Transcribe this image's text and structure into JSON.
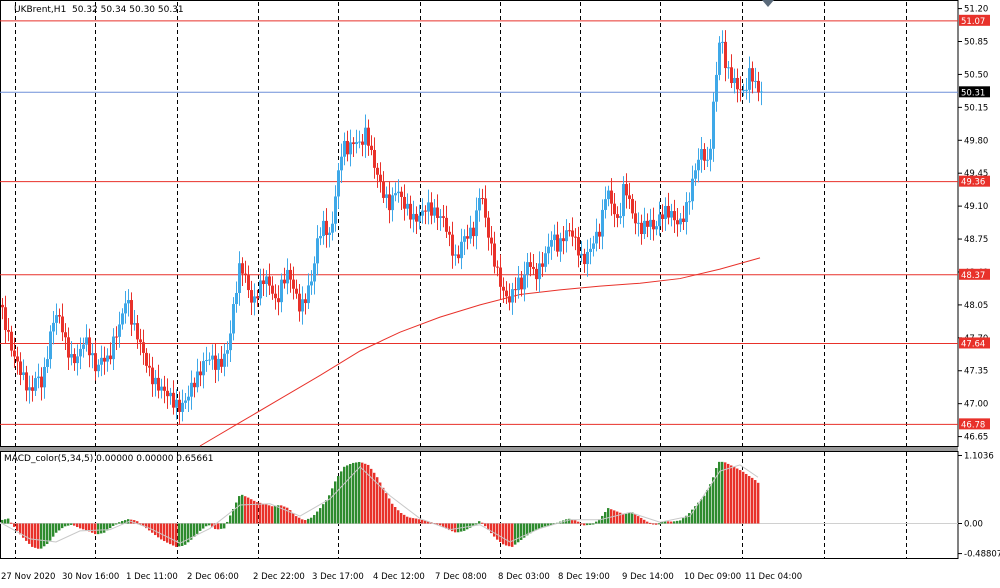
{
  "header": {
    "symbol": "UKBrent,H1",
    "ohlc": "50.32 50.34 50.30 50.31"
  },
  "macd_header": "MACD_color(5,34,5) 0.00000 0.00000 0.65661",
  "colors": {
    "bull": "#3ea8e8",
    "bear": "#e8312a",
    "level_line": "#e8312a",
    "ma": "#e8312a",
    "bid_line": "#6e8fd8",
    "macd_pos": "#2e8b2e",
    "macd_neg": "#e8312a",
    "macd_signal": "#c8c8c8"
  },
  "chart_data": [
    {
      "type": "candlestick",
      "title": "UKBrent,H1",
      "ylim": [
        46.55,
        51.27
      ],
      "y_ticks": [
        "51.20",
        "50.85",
        "50.50",
        "50.15",
        "49.80",
        "49.45",
        "49.10",
        "48.75",
        "48.40",
        "48.05",
        "47.70",
        "47.35",
        "47.00",
        "46.65"
      ],
      "x_ticks": [
        "27 Nov 2020",
        "30 Nov 16:00",
        "1 Dec 11:00",
        "2 Dec 06:00",
        "2 Dec 22:00",
        "3 Dec 17:00",
        "4 Dec 12:00",
        "7 Dec 08:00",
        "8 Dec 03:00",
        "8 Dec 19:00",
        "9 Dec 14:00",
        "10 Dec 09:00",
        "11 Dec 04:00"
      ],
      "levels": [
        51.07,
        49.36,
        48.37,
        47.64,
        46.78
      ],
      "current_price": 50.31,
      "close_path": [
        [
          0,
          48.05
        ],
        [
          6,
          47.8
        ],
        [
          12,
          47.55
        ],
        [
          18,
          47.4
        ],
        [
          24,
          47.25
        ],
        [
          30,
          47.1
        ],
        [
          36,
          47.3
        ],
        [
          42,
          47.2
        ],
        [
          48,
          47.6
        ],
        [
          54,
          47.95
        ],
        [
          60,
          47.9
        ],
        [
          66,
          47.6
        ],
        [
          72,
          47.45
        ],
        [
          78,
          47.5
        ],
        [
          84,
          47.7
        ],
        [
          90,
          47.55
        ],
        [
          96,
          47.35
        ],
        [
          102,
          47.5
        ],
        [
          108,
          47.45
        ],
        [
          114,
          47.7
        ],
        [
          120,
          47.85
        ],
        [
          126,
          48.15
        ],
        [
          132,
          47.85
        ],
        [
          138,
          47.7
        ],
        [
          144,
          47.5
        ],
        [
          150,
          47.3
        ],
        [
          156,
          47.2
        ],
        [
          162,
          47.15
        ],
        [
          168,
          47.1
        ],
        [
          174,
          47.0
        ],
        [
          180,
          46.95
        ],
        [
          186,
          47.05
        ],
        [
          192,
          47.2
        ],
        [
          198,
          47.3
        ],
        [
          204,
          47.45
        ],
        [
          210,
          47.5
        ],
        [
          216,
          47.4
        ],
        [
          222,
          47.45
        ],
        [
          228,
          47.6
        ],
        [
          234,
          48.1
        ],
        [
          240,
          48.5
        ],
        [
          246,
          48.3
        ],
        [
          252,
          48.05
        ],
        [
          258,
          48.2
        ],
        [
          264,
          48.35
        ],
        [
          270,
          48.25
        ],
        [
          276,
          48.05
        ],
        [
          282,
          48.3
        ],
        [
          288,
          48.4
        ],
        [
          294,
          48.2
        ],
        [
          300,
          48.0
        ],
        [
          306,
          48.15
        ],
        [
          312,
          48.35
        ],
        [
          318,
          48.8
        ],
        [
          324,
          48.9
        ],
        [
          330,
          48.75
        ],
        [
          336,
          49.3
        ],
        [
          342,
          49.75
        ],
        [
          348,
          49.7
        ],
        [
          354,
          49.8
        ],
        [
          360,
          49.75
        ],
        [
          366,
          49.9
        ],
        [
          372,
          49.6
        ],
        [
          378,
          49.4
        ],
        [
          384,
          49.2
        ],
        [
          390,
          49.1
        ],
        [
          396,
          49.3
        ],
        [
          402,
          49.15
        ],
        [
          408,
          49.05
        ],
        [
          414,
          48.95
        ],
        [
          420,
          49.0
        ],
        [
          426,
          49.1
        ],
        [
          432,
          49.05
        ],
        [
          438,
          49.0
        ],
        [
          444,
          48.95
        ],
        [
          450,
          48.7
        ],
        [
          456,
          48.5
        ],
        [
          462,
          48.75
        ],
        [
          468,
          48.8
        ],
        [
          474,
          48.85
        ],
        [
          480,
          49.3
        ],
        [
          486,
          48.9
        ],
        [
          492,
          48.6
        ],
        [
          498,
          48.35
        ],
        [
          504,
          48.15
        ],
        [
          510,
          48.1
        ],
        [
          516,
          48.3
        ],
        [
          522,
          48.25
        ],
        [
          528,
          48.55
        ],
        [
          534,
          48.35
        ],
        [
          540,
          48.45
        ],
        [
          546,
          48.6
        ],
        [
          552,
          48.8
        ],
        [
          558,
          48.65
        ],
        [
          564,
          48.8
        ],
        [
          570,
          48.85
        ],
        [
          576,
          48.7
        ],
        [
          582,
          48.5
        ],
        [
          588,
          48.6
        ],
        [
          594,
          48.75
        ],
        [
          600,
          48.85
        ],
        [
          606,
          49.3
        ],
        [
          612,
          49.1
        ],
        [
          618,
          48.9
        ],
        [
          624,
          49.35
        ],
        [
          630,
          49.1
        ],
        [
          636,
          48.9
        ],
        [
          642,
          48.85
        ],
        [
          648,
          48.95
        ],
        [
          654,
          48.85
        ],
        [
          660,
          49.0
        ],
        [
          666,
          49.05
        ],
        [
          672,
          49.0
        ],
        [
          678,
          48.9
        ],
        [
          684,
          49.0
        ],
        [
          690,
          49.25
        ],
        [
          696,
          49.55
        ],
        [
          702,
          49.7
        ],
        [
          708,
          49.5
        ],
        [
          714,
          50.3
        ],
        [
          720,
          50.95
        ],
        [
          726,
          50.55
        ],
        [
          732,
          50.45
        ],
        [
          738,
          50.35
        ],
        [
          744,
          50.3
        ],
        [
          750,
          50.55
        ],
        [
          756,
          50.35
        ],
        [
          762,
          50.31
        ]
      ],
      "ma": [
        [
          200,
          46.55
        ],
        [
          240,
          46.8
        ],
        [
          280,
          47.05
        ],
        [
          320,
          47.3
        ],
        [
          360,
          47.56
        ],
        [
          400,
          47.76
        ],
        [
          440,
          47.92
        ],
        [
          480,
          48.05
        ],
        [
          520,
          48.16
        ],
        [
          560,
          48.21
        ],
        [
          600,
          48.25
        ],
        [
          640,
          48.28
        ],
        [
          680,
          48.33
        ],
        [
          720,
          48.43
        ],
        [
          760,
          48.55
        ]
      ]
    },
    {
      "type": "bar",
      "title": "MACD_color(5,34,5)",
      "ylim": [
        -0.56,
        1.16
      ],
      "y_ticks": [
        "1.1036",
        "0.00",
        "-0.48807"
      ],
      "histogram_path": [
        [
          0,
          0.05
        ],
        [
          8,
          0.08
        ],
        [
          16,
          -0.1
        ],
        [
          24,
          -0.25
        ],
        [
          32,
          -0.38
        ],
        [
          40,
          -0.42
        ],
        [
          48,
          -0.32
        ],
        [
          56,
          -0.15
        ],
        [
          64,
          -0.05
        ],
        [
          72,
          -0.02
        ],
        [
          80,
          -0.08
        ],
        [
          88,
          -0.12
        ],
        [
          96,
          -0.18
        ],
        [
          104,
          -0.15
        ],
        [
          112,
          -0.05
        ],
        [
          120,
          0.03
        ],
        [
          128,
          0.07
        ],
        [
          136,
          0.05
        ],
        [
          144,
          -0.05
        ],
        [
          152,
          -0.15
        ],
        [
          160,
          -0.25
        ],
        [
          168,
          -0.32
        ],
        [
          176,
          -0.38
        ],
        [
          184,
          -0.36
        ],
        [
          192,
          -0.25
        ],
        [
          200,
          -0.12
        ],
        [
          208,
          -0.02
        ],
        [
          216,
          -0.1
        ],
        [
          224,
          -0.08
        ],
        [
          232,
          0.2
        ],
        [
          240,
          0.48
        ],
        [
          248,
          0.42
        ],
        [
          256,
          0.35
        ],
        [
          264,
          0.32
        ],
        [
          272,
          0.28
        ],
        [
          280,
          0.3
        ],
        [
          288,
          0.25
        ],
        [
          296,
          0.12
        ],
        [
          304,
          0.05
        ],
        [
          312,
          0.1
        ],
        [
          320,
          0.25
        ],
        [
          328,
          0.42
        ],
        [
          336,
          0.72
        ],
        [
          344,
          0.92
        ],
        [
          352,
          0.98
        ],
        [
          360,
          1.0
        ],
        [
          368,
          0.95
        ],
        [
          376,
          0.78
        ],
        [
          384,
          0.55
        ],
        [
          392,
          0.32
        ],
        [
          400,
          0.18
        ],
        [
          408,
          0.1
        ],
        [
          416,
          0.08
        ],
        [
          424,
          0.05
        ],
        [
          432,
          0.02
        ],
        [
          440,
          -0.03
        ],
        [
          448,
          -0.1
        ],
        [
          456,
          -0.15
        ],
        [
          464,
          -0.12
        ],
        [
          472,
          -0.05
        ],
        [
          480,
          0.05
        ],
        [
          488,
          -0.1
        ],
        [
          496,
          -0.25
        ],
        [
          504,
          -0.35
        ],
        [
          512,
          -0.38
        ],
        [
          520,
          -0.28
        ],
        [
          528,
          -0.18
        ],
        [
          536,
          -0.1
        ],
        [
          544,
          -0.05
        ],
        [
          552,
          -0.02
        ],
        [
          560,
          0.03
        ],
        [
          568,
          0.08
        ],
        [
          576,
          0.05
        ],
        [
          584,
          -0.03
        ],
        [
          592,
          -0.02
        ],
        [
          600,
          0.08
        ],
        [
          608,
          0.25
        ],
        [
          616,
          0.2
        ],
        [
          624,
          0.15
        ],
        [
          632,
          0.18
        ],
        [
          640,
          0.1
        ],
        [
          648,
          0.02
        ],
        [
          656,
          -0.02
        ],
        [
          664,
          0.04
        ],
        [
          672,
          0.03
        ],
        [
          680,
          0.05
        ],
        [
          688,
          0.15
        ],
        [
          696,
          0.3
        ],
        [
          704,
          0.45
        ],
        [
          712,
          0.7
        ],
        [
          718,
          1.0
        ],
        [
          724,
          1.0
        ],
        [
          730,
          0.95
        ],
        [
          736,
          0.9
        ],
        [
          742,
          0.85
        ],
        [
          748,
          0.78
        ],
        [
          754,
          0.72
        ],
        [
          758,
          0.66
        ]
      ],
      "signal_path": [
        [
          0,
          0.02
        ],
        [
          30,
          -0.25
        ],
        [
          56,
          -0.3
        ],
        [
          80,
          -0.12
        ],
        [
          110,
          -0.1
        ],
        [
          130,
          0.04
        ],
        [
          150,
          -0.08
        ],
        [
          180,
          -0.32
        ],
        [
          210,
          -0.08
        ],
        [
          240,
          0.3
        ],
        [
          270,
          0.32
        ],
        [
          300,
          0.12
        ],
        [
          330,
          0.4
        ],
        [
          360,
          0.92
        ],
        [
          390,
          0.45
        ],
        [
          420,
          0.08
        ],
        [
          450,
          -0.1
        ],
        [
          480,
          -0.02
        ],
        [
          510,
          -0.3
        ],
        [
          540,
          -0.08
        ],
        [
          570,
          0.06
        ],
        [
          600,
          0.06
        ],
        [
          630,
          0.18
        ],
        [
          660,
          0.02
        ],
        [
          690,
          0.12
        ],
        [
          720,
          0.85
        ],
        [
          740,
          0.95
        ],
        [
          758,
          0.75
        ]
      ]
    }
  ]
}
